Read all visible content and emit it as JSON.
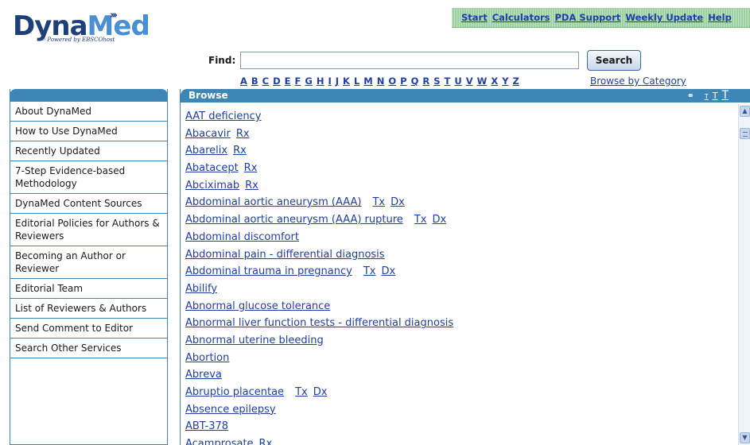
{
  "logo": {
    "name_part1": "Dyna",
    "name_part2": "Med",
    "tagline": "Powered by EBSCOhost",
    "icon": "triple-chevron-icon"
  },
  "topnav": [
    "Start",
    "Calculators",
    "PDA Support",
    "Weekly Update",
    "Help"
  ],
  "find": {
    "label": "Find:",
    "value": "",
    "search_label": "Search"
  },
  "alphabet": [
    "A",
    "B",
    "C",
    "D",
    "E",
    "F",
    "G",
    "H",
    "I",
    "J",
    "K",
    "L",
    "M",
    "N",
    "O",
    "P",
    "Q",
    "R",
    "S",
    "T",
    "U",
    "V",
    "W",
    "X",
    "Y",
    "Z"
  ],
  "browse_by_category": "Browse by Category",
  "sidebar": {
    "items": [
      "About DynaMed",
      "How to Use DynaMed",
      "Recently Updated",
      "7-Step Evidence-based Methodology",
      "DynaMed Content Sources",
      "Editorial Policies for Authors & Reviewers",
      "Becoming an Author or Reviewer",
      "Editorial Team",
      "List of Reviewers & Authors",
      "Send Comment to Editor",
      "Search Other Services"
    ]
  },
  "browse": {
    "title": "Browse",
    "text_sizes": [
      "T",
      "T",
      "T"
    ],
    "entries": [
      {
        "name": "AAT deficiency",
        "tags": []
      },
      {
        "name": "Abacavir",
        "tags": [
          "Rx"
        ]
      },
      {
        "name": "Abarelix",
        "tags": [
          "Rx"
        ]
      },
      {
        "name": "Abatacept",
        "tags": [
          "Rx"
        ]
      },
      {
        "name": "Abciximab",
        "tags": [
          "Rx"
        ]
      },
      {
        "name": "Abdominal aortic aneurysm (AAA)",
        "tags": [
          "Tx",
          "Dx"
        ]
      },
      {
        "name": "Abdominal aortic aneurysm (AAA) rupture",
        "tags": [
          "Tx",
          "Dx"
        ]
      },
      {
        "name": "Abdominal discomfort",
        "tags": []
      },
      {
        "name": "Abdominal pain - differential diagnosis",
        "tags": []
      },
      {
        "name": "Abdominal trauma in pregnancy",
        "tags": [
          "Tx",
          "Dx"
        ]
      },
      {
        "name": "Abilify",
        "tags": []
      },
      {
        "name": "Abnormal glucose tolerance",
        "tags": []
      },
      {
        "name": "Abnormal liver function tests - differential diagnosis",
        "tags": []
      },
      {
        "name": "Abnormal uterine bleeding",
        "tags": []
      },
      {
        "name": "Abortion",
        "tags": []
      },
      {
        "name": "Abreva",
        "tags": []
      },
      {
        "name": "Abruptio placentae",
        "tags": [
          "Tx",
          "Dx"
        ]
      },
      {
        "name": "Absence epilepsy",
        "tags": []
      },
      {
        "name": "ABT-378",
        "tags": []
      },
      {
        "name": "Acamprosate",
        "tags": [
          "Rx"
        ]
      }
    ]
  },
  "colors": {
    "panel_blue": "#3e86b5",
    "link_blue": "#1f3fa6",
    "nav_green": "#9ed1a1"
  }
}
